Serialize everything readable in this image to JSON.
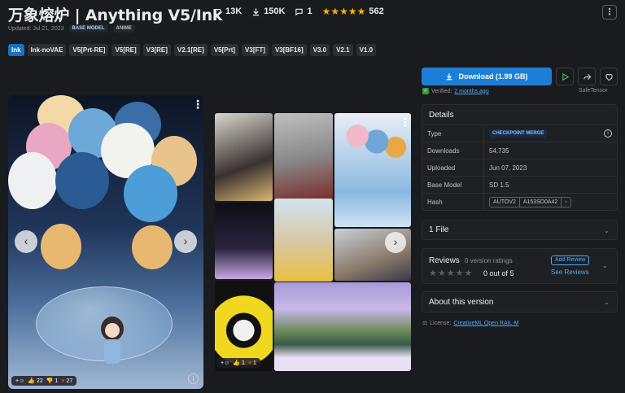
{
  "model": {
    "title": "万象熔炉 | Anything V5/Ink",
    "likes": "13K",
    "downloads": "150K",
    "comments": "1",
    "rating_count": "562",
    "updated": "Updated: Jul 21, 2023",
    "tags": [
      "BASE MODEL",
      "ANIME"
    ]
  },
  "versions": [
    "Ink",
    "Ink-noVAE",
    "V5[Prt-RE]",
    "V5[RE]",
    "V3[RE]",
    "V2.1[RE]",
    "V5[Prt]",
    "V3[FT]",
    "V3[BF16]",
    "V3.0",
    "V2.1",
    "V1.0"
  ],
  "main_image": {
    "reactions": {
      "like": "22",
      "dislike": "1",
      "heart": "27"
    }
  },
  "gallery": {
    "reactions": {
      "like": "1",
      "heart": "1"
    }
  },
  "sidebar": {
    "download_label": "Download (1.99 GB)",
    "verified_prefix": "Verified:",
    "verified_when": "2 months ago",
    "safetensor": "SafeTensor",
    "details_title": "Details",
    "details": {
      "type_label": "Type",
      "type_value": "CHECKPOINT MERGE",
      "downloads_label": "Downloads",
      "downloads_value": "54,735",
      "uploaded_label": "Uploaded",
      "uploaded_value": "Jun 07, 2023",
      "base_model_label": "Base Model",
      "base_model_value": "SD 1.5",
      "hash_label": "Hash",
      "hash_type": "AUTOV2",
      "hash_value": "A153SD0A42"
    },
    "files_title": "1 File",
    "reviews_title": "Reviews",
    "reviews_count": "0 version ratings",
    "reviews_score": "0 out of 5",
    "add_review": "Add Review",
    "see_reviews": "See Reviews",
    "about_title": "About this version",
    "license_prefix": "License:",
    "license_name": "CreativeML Open RAIL-M"
  },
  "colors": {
    "accent": "#1c7ed6",
    "star": "#fab005",
    "background": "#1a1b1e"
  }
}
